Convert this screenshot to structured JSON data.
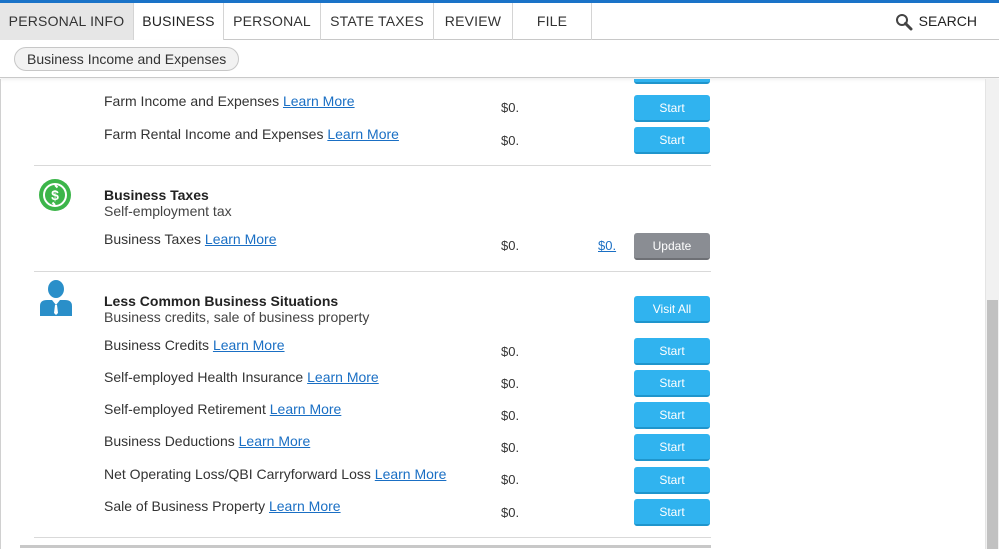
{
  "nav": {
    "tabs": [
      {
        "label": "PERSONAL INFO"
      },
      {
        "label": "BUSINESS"
      },
      {
        "label": "PERSONAL"
      },
      {
        "label": "STATE TAXES"
      },
      {
        "label": "REVIEW"
      },
      {
        "label": "FILE"
      }
    ],
    "search_label": "SEARCH"
  },
  "breadcrumb": "Business Income and Expenses",
  "farm": {
    "rows": [
      {
        "label": "Farm Income and Expenses",
        "link": "Learn More",
        "amount": "$0.",
        "button": "Start"
      },
      {
        "label": "Farm Rental Income and Expenses",
        "link": "Learn More",
        "amount": "$0.",
        "button": "Start"
      }
    ]
  },
  "business_taxes": {
    "title": "Business Taxes",
    "subtitle": "Self-employment tax",
    "rows": [
      {
        "label": "Business Taxes",
        "link": "Learn More",
        "amount": "$0.",
        "amount_link": "$0.",
        "button": "Update"
      }
    ]
  },
  "less_common": {
    "title": "Less Common Business Situations",
    "subtitle": "Business credits, sale of business property",
    "visit_all": "Visit All",
    "rows": [
      {
        "label": "Business Credits",
        "link": "Learn More",
        "amount": "$0.",
        "button": "Start"
      },
      {
        "label": "Self-employed Health Insurance",
        "link": "Learn More",
        "amount": "$0.",
        "button": "Start"
      },
      {
        "label": "Self-employed Retirement",
        "link": "Learn More",
        "amount": "$0.",
        "button": "Start"
      },
      {
        "label": "Business Deductions",
        "link": "Learn More",
        "amount": "$0.",
        "button": "Start"
      },
      {
        "label": "Net Operating Loss/QBI Carryforward Loss",
        "link": "Learn More",
        "amount": "$0.",
        "button": "Start"
      },
      {
        "label": "Sale of Business Property",
        "link": "Learn More",
        "amount": "$0.",
        "button": "Start"
      }
    ]
  },
  "colors": {
    "accent": "#1a73c8",
    "button": "#30b3ef",
    "button_gray": "#8a8d93",
    "link": "#1a6fc4",
    "icon_green": "#3cb54a",
    "icon_blue": "#2a8fc9"
  }
}
